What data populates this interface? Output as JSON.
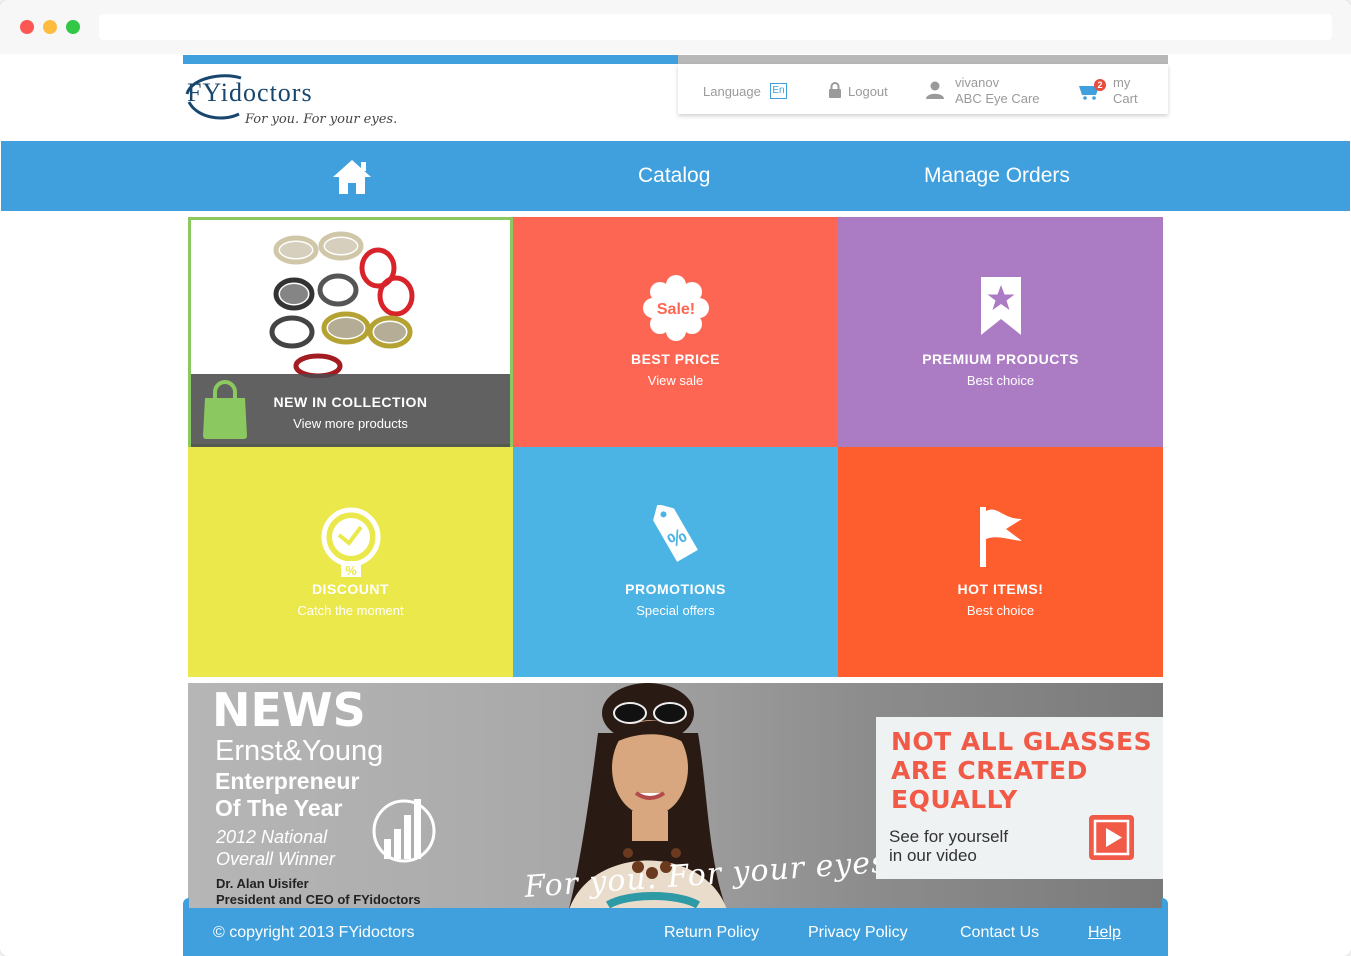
{
  "brand": {
    "name": "FYidoctors",
    "tagline": "For you. For your eyes."
  },
  "userbar": {
    "language_label": "Language",
    "language_code": "En",
    "logout_label": "Logout",
    "username": "vivanov",
    "company": "ABC Eye Care",
    "cart_count": "2",
    "cart_line1": "my",
    "cart_line2": "Cart"
  },
  "nav": {
    "home_icon": "home-icon",
    "catalog": "Catalog",
    "manage_orders": "Manage Orders"
  },
  "tiles": [
    {
      "title": "NEW IN COLLECTION",
      "subtitle": "View more products",
      "icon": "shopping-bag-icon",
      "color": "#8cc860"
    },
    {
      "title": "BEST PRICE",
      "subtitle": "View sale",
      "icon": "sale-badge-icon",
      "badge_text": "Sale!",
      "color": "#fd6652"
    },
    {
      "title": "PREMIUM PRODUCTS",
      "subtitle": "Best choice",
      "icon": "star-ribbon-icon",
      "color": "#ab7bc4"
    },
    {
      "title": "DISCOUNT",
      "subtitle": "Catch the moment",
      "icon": "clock-percent-icon",
      "color": "#ebe84c"
    },
    {
      "title": "PROMOTIONS",
      "subtitle": "Special offers",
      "icon": "percent-tag-icon",
      "color": "#4bb4e5"
    },
    {
      "title": "HOT ITEMS!",
      "subtitle": "Best choice",
      "icon": "flag-icon",
      "color": "#fe5d2e"
    }
  ],
  "news": {
    "heading": "NEWS",
    "line1": "Ernst&Young",
    "line2a": "Enterpreneur",
    "line2b": "Of The Year",
    "line3a": "2012 National",
    "line3b": "Overall Winner",
    "person_name": "Dr. Alan Uisifer",
    "person_title": "President and CEO of FYidoctors",
    "tagline": "For you. For your eyes.",
    "promo_title_1": "NOT ALL GLASSES",
    "promo_title_2": "ARE CREATED",
    "promo_title_3": "EQUALLY",
    "promo_sub_1": "See for yourself",
    "promo_sub_2": "in our video"
  },
  "footer": {
    "copyright": "© copyright 2013 FYidoctors",
    "return_policy": "Return Policy",
    "privacy_policy": "Privacy Policy",
    "contact_us": "Contact Us",
    "help": "Help"
  },
  "colors": {
    "primary_blue": "#3fa0dd",
    "promo_red": "#f15a47"
  }
}
